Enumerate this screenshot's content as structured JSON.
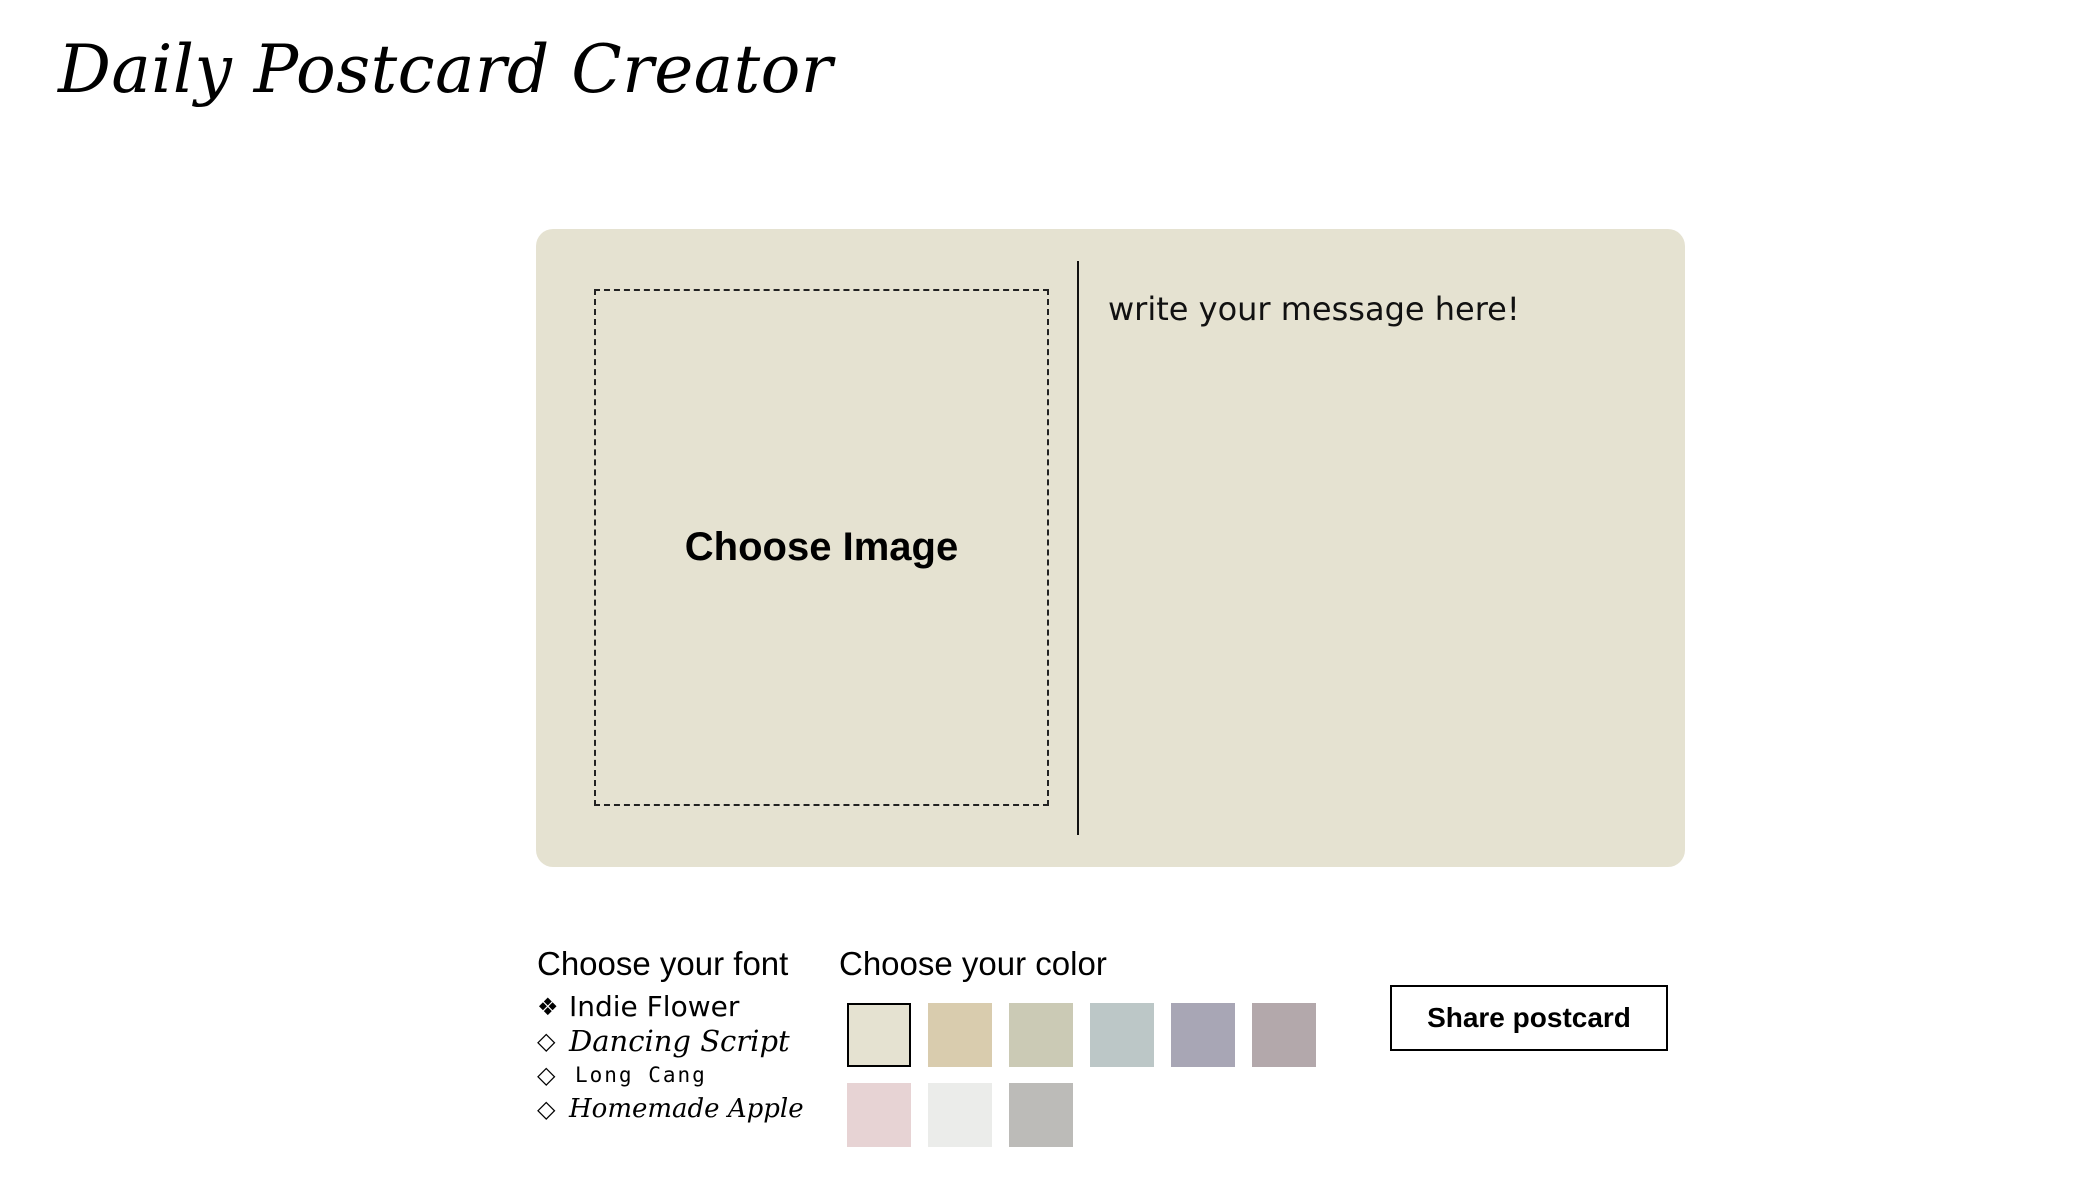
{
  "app": {
    "title": "Daily Postcard Creator"
  },
  "postcard": {
    "background_color": "#e5e2d1",
    "image_picker_label": "Choose Image",
    "message_placeholder": "write your message here!"
  },
  "font_section": {
    "label": "Choose your font",
    "selected_marker": "❖",
    "unselected_marker": "◇",
    "options": [
      {
        "label": "Indie Flower",
        "selected": true
      },
      {
        "label": "Dancing Script",
        "selected": false
      },
      {
        "label": "Long Cang",
        "selected": false
      },
      {
        "label": "Homemade Apple",
        "selected": false
      }
    ]
  },
  "color_section": {
    "label": "Choose your color",
    "swatches": [
      {
        "color": "#e5e2d1",
        "selected": true
      },
      {
        "color": "#d9ccae",
        "selected": false
      },
      {
        "color": "#cbcab5",
        "selected": false
      },
      {
        "color": "#bcc7c7",
        "selected": false
      },
      {
        "color": "#a8a6b5",
        "selected": false
      },
      {
        "color": "#b3a8ab",
        "selected": false
      },
      {
        "color": "#e7d3d4",
        "selected": false
      },
      {
        "color": "#ebecea",
        "selected": false
      },
      {
        "color": "#bcbbb8",
        "selected": false
      }
    ]
  },
  "actions": {
    "share_label": "Share postcard"
  }
}
